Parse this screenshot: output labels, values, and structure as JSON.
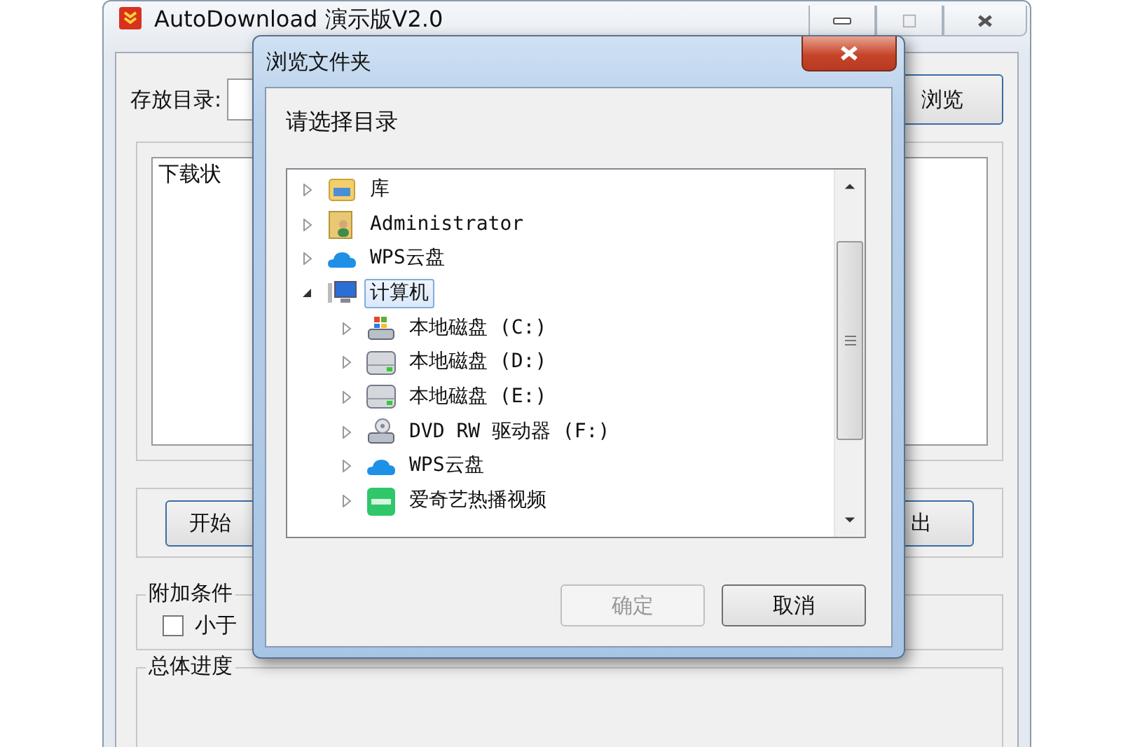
{
  "main_window": {
    "title": "AutoDownload 演示版V2.0",
    "save_dir_label": "存放目录:",
    "browse_button": "浏览",
    "status_group": "下载状",
    "start_button": "开始",
    "exit_button": "出",
    "conditions_group": "附加条件",
    "size_option": {
      "label": "小于",
      "checked": false
    },
    "progress_group": "总体进度"
  },
  "dialog": {
    "title": "浏览文件夹",
    "prompt": "请选择目录",
    "tree": [
      {
        "label": "库",
        "kind": "library",
        "expanded": false,
        "selected": false
      },
      {
        "label": "Administrator",
        "kind": "user",
        "expanded": false,
        "selected": false
      },
      {
        "label": "WPS云盘",
        "kind": "cloud",
        "expanded": false,
        "selected": false
      },
      {
        "label": "计算机",
        "kind": "computer",
        "expanded": true,
        "selected": true,
        "children": [
          {
            "label": "本地磁盘 (C:)",
            "kind": "system_drive",
            "expanded": false,
            "selected": false
          },
          {
            "label": "本地磁盘 (D:)",
            "kind": "drive",
            "expanded": false,
            "selected": false
          },
          {
            "label": "本地磁盘 (E:)",
            "kind": "drive",
            "expanded": false,
            "selected": false
          },
          {
            "label": "DVD RW 驱动器 (F:)",
            "kind": "dvd_drive",
            "expanded": false,
            "selected": false
          },
          {
            "label": "WPS云盘",
            "kind": "cloud",
            "expanded": false,
            "selected": false
          },
          {
            "label": "爱奇艺热播视频",
            "kind": "app",
            "expanded": false,
            "selected": false
          }
        ]
      }
    ],
    "buttons": [
      {
        "label": "确定",
        "disabled": true
      },
      {
        "label": "取消",
        "disabled": false
      }
    ]
  }
}
